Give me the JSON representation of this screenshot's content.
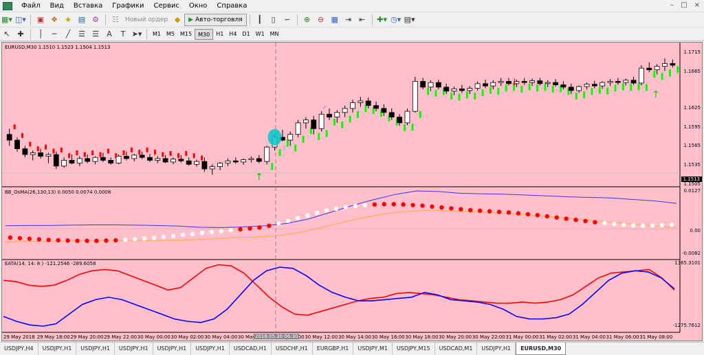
{
  "menu": [
    "Файл",
    "Вид",
    "Вставка",
    "Графики",
    "Сервис",
    "Окно",
    "Справка"
  ],
  "toolbar": {
    "new_order_label": "Новый ордер",
    "autotrade_label": "Авто-торговля"
  },
  "timeframes": [
    "M1",
    "M5",
    "M15",
    "M30",
    "H1",
    "H4",
    "D1",
    "W1",
    "MN"
  ],
  "active_timeframe": "M30",
  "tools_text": [
    "A",
    "T"
  ],
  "chart": {
    "main_title": "EURUSD,M30  1.1510 1.1523 1.1504 1.1513",
    "price_ticks": [
      "1.1715",
      "1.1665",
      "1.1625",
      "1.1595",
      "1.1565",
      "1.1535",
      "1.1505"
    ],
    "current_price": "1.1513",
    "osma_title": "BB_OsMA(26,130,13) 0.0050 0.0074 0.0008",
    "osma_ticks": [
      "0.0127",
      "0.00",
      "-0.0082"
    ],
    "eata_title": "EATA(14, 14: 8 ) -121.2546 -289.6058",
    "eata_ticks": [
      "1365.3101",
      "-1275.7612"
    ],
    "time_ticks": [
      "29 May 2018",
      "29 May 18:00",
      "29 May 20:00",
      "29 May 22:00",
      "30 May 00:00",
      "30 May 02:00",
      "30 May 04:00",
      "30 May 0",
      "30 May 10:00",
      "30 May 12:00",
      "30 May 14:00",
      "30 May 16:00",
      "30 May 18:00",
      "30 May 20:00",
      "30 May 22:00",
      "31 May 00:00",
      "31 May 02:00",
      "31 May 04:00",
      "31 May 06:00",
      "31 May 08:00"
    ],
    "cursor_time": "2018.05.30 06:30",
    "colors": {
      "background": "#ffc0cb",
      "bull": "#ffffff",
      "bear": "#000000",
      "buy_signal": "#00ff00",
      "sell_signal": "#ff0000",
      "osma_blue": "#3333ff",
      "osma_orange": "#ffaa33",
      "eata_red": "#ff0000",
      "eata_blue": "#0000ff",
      "highlight": "#00c8c8"
    }
  },
  "tabs": [
    "USDJPY,H4",
    "USDJPY,H1",
    "USDJPY,H1",
    "USDJPY,H1",
    "USDJPY,H1",
    "USDJPY,H1",
    "USDCAD,H1",
    "USDCHF,H1",
    "EURGBP,H1",
    "USDJPY,M1",
    "USDJPY,M15",
    "USDCAD,M1",
    "USDJPY,H1",
    "EURUSD,M30"
  ],
  "active_tab": "EURUSD,M30",
  "chart_data": [
    {
      "type": "candlestick",
      "title": "EURUSD,M30  1.1510 1.1523 1.1504 1.1513",
      "ylim": [
        1.1495,
        1.1725
      ],
      "candles": [
        [
          1.158,
          1.159,
          1.156,
          1.157
        ],
        [
          1.157,
          1.1575,
          1.155,
          1.1555
        ],
        [
          1.1555,
          1.156,
          1.154,
          1.1545
        ],
        [
          1.1545,
          1.1552,
          1.1535,
          1.1548
        ],
        [
          1.1548,
          1.1555,
          1.1538,
          1.1542
        ],
        [
          1.1542,
          1.1548,
          1.153,
          1.1545
        ],
        [
          1.1545,
          1.155,
          1.152,
          1.1525
        ],
        [
          1.1525,
          1.154,
          1.1522,
          1.1535
        ],
        [
          1.1535,
          1.1545,
          1.1528,
          1.153
        ],
        [
          1.153,
          1.1542,
          1.1525,
          1.1538
        ],
        [
          1.1538,
          1.1545,
          1.153,
          1.1533
        ],
        [
          1.1533,
          1.1542,
          1.1528,
          1.154
        ],
        [
          1.154,
          1.1548,
          1.1532,
          1.1535
        ],
        [
          1.1535,
          1.154,
          1.1527,
          1.153
        ],
        [
          1.153,
          1.1545,
          1.1528,
          1.1542
        ],
        [
          1.1542,
          1.155,
          1.1535,
          1.1538
        ],
        [
          1.1538,
          1.1546,
          1.1533,
          1.1544
        ],
        [
          1.1544,
          1.155,
          1.1537,
          1.154
        ],
        [
          1.154,
          1.1546,
          1.1532,
          1.1535
        ],
        [
          1.1535,
          1.1542,
          1.153,
          1.1538
        ],
        [
          1.1538,
          1.1544,
          1.153,
          1.1532
        ],
        [
          1.1532,
          1.154,
          1.1528,
          1.1537
        ],
        [
          1.1537,
          1.1544,
          1.1531,
          1.1534
        ],
        [
          1.1534,
          1.154,
          1.1526,
          1.1528
        ],
        [
          1.1528,
          1.1536,
          1.1524,
          1.1533
        ],
        [
          1.1533,
          1.154,
          1.1515,
          1.152
        ],
        [
          1.152,
          1.1528,
          1.151,
          1.1524
        ],
        [
          1.1524,
          1.1532,
          1.1518,
          1.153
        ],
        [
          1.153,
          1.1538,
          1.1525,
          1.1534
        ],
        [
          1.1534,
          1.154,
          1.1529,
          1.1532
        ],
        [
          1.1532,
          1.1538,
          1.1527,
          1.1536
        ],
        [
          1.1536,
          1.1542,
          1.1531,
          1.1538
        ],
        [
          1.1538,
          1.1544,
          1.153,
          1.1533
        ],
        [
          1.1533,
          1.156,
          1.1528,
          1.1558
        ],
        [
          1.1558,
          1.158,
          1.1552,
          1.1575
        ],
        [
          1.1575,
          1.1588,
          1.1568,
          1.157
        ],
        [
          1.157,
          1.1585,
          1.156,
          1.158
        ],
        [
          1.158,
          1.1605,
          1.1575,
          1.16
        ],
        [
          1.16,
          1.161,
          1.159,
          1.1605
        ],
        [
          1.1605,
          1.1612,
          1.158,
          1.159
        ],
        [
          1.159,
          1.162,
          1.1585,
          1.1615
        ],
        [
          1.1615,
          1.1625,
          1.1605,
          1.161
        ],
        [
          1.161,
          1.1622,
          1.16,
          1.1618
        ],
        [
          1.1618,
          1.163,
          1.161,
          1.1625
        ],
        [
          1.1625,
          1.164,
          1.1618,
          1.1635
        ],
        [
          1.1635,
          1.1645,
          1.1628,
          1.1638
        ],
        [
          1.1638,
          1.1644,
          1.1625,
          1.163
        ],
        [
          1.163,
          1.1637,
          1.162,
          1.1625
        ],
        [
          1.1625,
          1.1632,
          1.1612,
          1.1618
        ],
        [
          1.1618,
          1.1625,
          1.1605,
          1.161
        ],
        [
          1.161,
          1.1615,
          1.1595,
          1.16
        ],
        [
          1.16,
          1.1625,
          1.1596,
          1.162
        ],
        [
          1.162,
          1.168,
          1.1618,
          1.1672
        ],
        [
          1.1672,
          1.1678,
          1.1658,
          1.1662
        ],
        [
          1.1662,
          1.1674,
          1.1655,
          1.167
        ],
        [
          1.167,
          1.1675,
          1.1658,
          1.1662
        ],
        [
          1.1662,
          1.1668,
          1.165,
          1.1655
        ],
        [
          1.1655,
          1.1663,
          1.1648,
          1.1659
        ],
        [
          1.1659,
          1.1666,
          1.1652,
          1.1656
        ],
        [
          1.1656,
          1.1664,
          1.165,
          1.166
        ],
        [
          1.166,
          1.1672,
          1.1656,
          1.1668
        ],
        [
          1.1668,
          1.1675,
          1.166,
          1.1664
        ],
        [
          1.1664,
          1.1674,
          1.1658,
          1.167
        ],
        [
          1.167,
          1.1678,
          1.1664,
          1.1672
        ],
        [
          1.1672,
          1.1678,
          1.1665,
          1.1668
        ],
        [
          1.1668,
          1.1675,
          1.1662,
          1.1672
        ],
        [
          1.1672,
          1.1678,
          1.1666,
          1.167
        ],
        [
          1.167,
          1.1677,
          1.1664,
          1.1673
        ],
        [
          1.1673,
          1.1678,
          1.1665,
          1.1668
        ],
        [
          1.1668,
          1.1674,
          1.1662,
          1.167
        ],
        [
          1.167,
          1.1676,
          1.1663,
          1.1666
        ],
        [
          1.1666,
          1.1672,
          1.1658,
          1.1662
        ],
        [
          1.1662,
          1.1668,
          1.165,
          1.1656
        ],
        [
          1.1656,
          1.1665,
          1.1652,
          1.1663
        ],
        [
          1.1663,
          1.167,
          1.1658,
          1.1667
        ],
        [
          1.1667,
          1.1673,
          1.166,
          1.1664
        ],
        [
          1.1664,
          1.1672,
          1.1659,
          1.167
        ],
        [
          1.167,
          1.1676,
          1.1664,
          1.1672
        ],
        [
          1.1672,
          1.1678,
          1.1666,
          1.167
        ],
        [
          1.167,
          1.1677,
          1.1665,
          1.1674
        ],
        [
          1.1674,
          1.168,
          1.1666,
          1.1669
        ],
        [
          1.1669,
          1.17,
          1.1665,
          1.1695
        ],
        [
          1.1695,
          1.1705,
          1.1688,
          1.1692
        ],
        [
          1.1692,
          1.1702,
          1.1684,
          1.1698
        ],
        [
          1.1698,
          1.1712,
          1.169,
          1.1703
        ],
        [
          1.1703,
          1.171,
          1.1696,
          1.17
        ]
      ]
    },
    {
      "type": "line",
      "title": "BB_OsMA(26,130,13) 0.0050 0.0074 0.0008",
      "ylim": [
        -0.0095,
        0.0135
      ],
      "series": [
        {
          "values": [
            0.001,
            0.0011,
            0.0011,
            0.0012,
            0.0013,
            0.0013,
            0.0012,
            0.0011,
            0.0009,
            0.0005,
            0.0004,
            0.0006,
            0.001,
            0.0018,
            0.0033,
            0.0055,
            0.0078,
            0.0098,
            0.0116,
            0.0128,
            0.0126,
            0.012,
            0.0118,
            0.0117,
            0.0114,
            0.0111,
            0.0108,
            0.0106,
            0.0104,
            0.0099,
            0.0094,
            0.0086
          ]
        },
        {
          "values": [
            -0.0045,
            -0.0043,
            -0.0042,
            -0.0041,
            -0.004,
            -0.004,
            -0.004,
            -0.0039,
            -0.0036,
            -0.0031,
            -0.0028,
            -0.0024,
            -0.001,
            0.001,
            0.003,
            0.0047,
            0.0058,
            0.0062,
            0.006,
            0.0057,
            0.0052,
            0.0046,
            0.004,
            0.0032,
            0.0025,
            0.0017,
            0.001,
            0.0004
          ]
        }
      ],
      "dots": [
        -0.003,
        -0.0032,
        -0.0034,
        -0.0036,
        -0.0038,
        -0.0039,
        -0.004,
        -0.0041,
        -0.0041,
        -0.0041,
        -0.004,
        -0.0039,
        -0.0037,
        -0.0035,
        -0.0033,
        -0.0031,
        -0.0028,
        -0.0025,
        -0.0021,
        -0.0018,
        -0.0014,
        -0.0011,
        -0.0008,
        -0.0005,
        -0.0002,
        0.0001,
        0.0004,
        0.001,
        0.0018,
        0.0027,
        0.0036,
        0.0045,
        0.0054,
        0.0062,
        0.0068,
        0.0073,
        0.0077,
        0.008,
        0.0082,
        0.0083,
        0.0083,
        0.0082,
        0.008,
        0.0078,
        0.0075,
        0.0072,
        0.0069,
        0.0066,
        0.0063,
        0.0061,
        0.0059,
        0.0057,
        0.0055,
        0.0052,
        0.0049,
        0.0046,
        0.0042,
        0.0038,
        0.0034,
        0.003,
        0.0026,
        0.0022,
        0.0019,
        0.0016,
        0.0013,
        0.0011,
        0.001,
        0.0011,
        0.0012,
        0.0013
      ]
    },
    {
      "type": "line",
      "title": "EATA(14, 14: 8 ) -121.2546 -289.6058",
      "ylim": [
        -1400,
        1450
      ],
      "series": [
        {
          "values": [
            700,
            650,
            500,
            450,
            500,
            700,
            950,
            1100,
            1150,
            1100,
            900,
            700,
            500,
            300,
            400,
            800,
            1200,
            1350,
            1300,
            1000,
            500,
            0,
            -400,
            -700,
            -750,
            -600,
            -450,
            -300,
            -150,
            -50,
            0,
            150,
            200,
            150,
            100,
            0,
            -100,
            -150,
            -200,
            -250,
            -250,
            -200,
            -250,
            -200,
            -100,
            100,
            450,
            800,
            1000,
            1050,
            1100,
            1150,
            800,
            300
          ]
        },
        {
          "values": [
            -800,
            -1000,
            -1150,
            -1200,
            -1100,
            -700,
            -300,
            -100,
            0,
            -100,
            -300,
            -500,
            -700,
            -900,
            -1000,
            -1050,
            -900,
            -500,
            100,
            700,
            1100,
            1250,
            1200,
            900,
            500,
            200,
            0,
            -150,
            -150,
            -100,
            -50,
            0,
            200,
            100,
            -100,
            -150,
            -200,
            -300,
            -500,
            -800,
            -900,
            -900,
            -850,
            -700,
            -300,
            200,
            700,
            1000,
            1100,
            1050,
            800,
            350
          ]
        }
      ]
    }
  ]
}
